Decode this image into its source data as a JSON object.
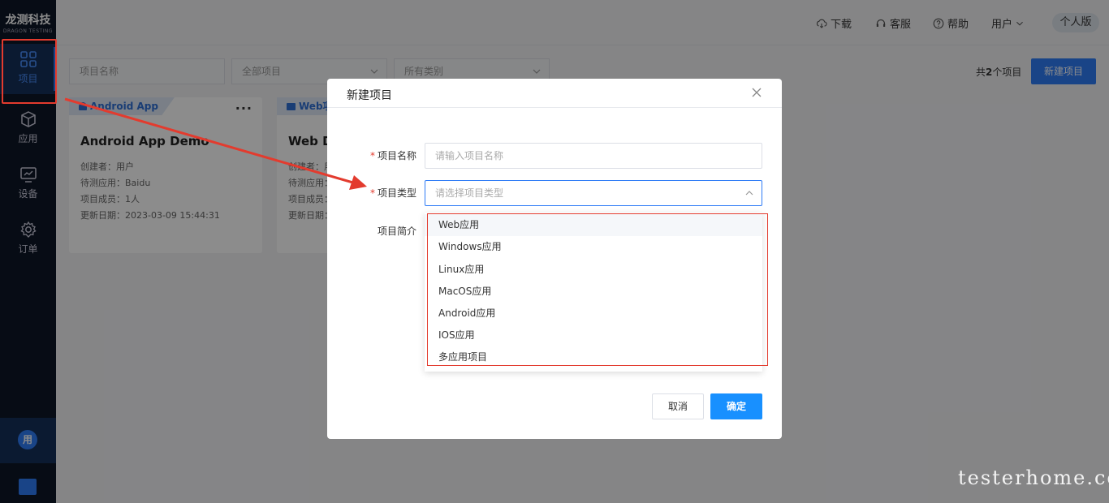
{
  "app": {
    "logo_cn": "龙测科技",
    "logo_en": "DRAGON TESTING"
  },
  "sidebar": {
    "items": [
      {
        "label": "项目",
        "icon": "grid-icon",
        "active": true
      },
      {
        "label": "应用",
        "icon": "cube-icon",
        "active": false
      },
      {
        "label": "设备",
        "icon": "monitor-icon",
        "active": false
      },
      {
        "label": "订单",
        "icon": "gear-icon",
        "active": false
      }
    ],
    "avatar_text": "用",
    "org_icon": "building-icon"
  },
  "header": {
    "download": "下载",
    "service": "客服",
    "help": "帮助",
    "user": "用户",
    "edition": "个人版"
  },
  "toolbar": {
    "name_placeholder": "项目名称",
    "all_projects": "全部项目",
    "all_categories": "所有类别",
    "count_prefix": "共",
    "count_value": "2",
    "count_suffix": "个项目",
    "new_project": "新建项目"
  },
  "cards": [
    {
      "tag": "Android App",
      "title": "Android App Demo",
      "creator": "创建者：用户",
      "app": "待测应用：Baidu",
      "members": "项目成员：1人",
      "updated": "更新日期：2023-03-09 15:44:31"
    },
    {
      "tag": "Web项",
      "title": "Web De",
      "creator": "创建者：用",
      "app": "待测应用：",
      "members": "项目成员：",
      "updated": "更新日期："
    }
  ],
  "modal": {
    "title": "新建项目",
    "name_label": "项目名称",
    "name_placeholder": "请输入项目名称",
    "type_label": "项目类型",
    "type_placeholder": "请选择项目类型",
    "desc_label": "项目简介",
    "cancel": "取消",
    "ok": "确定",
    "type_options": [
      "Web应用",
      "Windows应用",
      "Linux应用",
      "MacOS应用",
      "Android应用",
      "IOS应用",
      "多应用项目"
    ]
  },
  "watermark": "testerhome.com",
  "colors": {
    "primary": "#2f7cf6",
    "sidebar_bg": "#0e1727",
    "highlight_red": "#e33b2e"
  }
}
